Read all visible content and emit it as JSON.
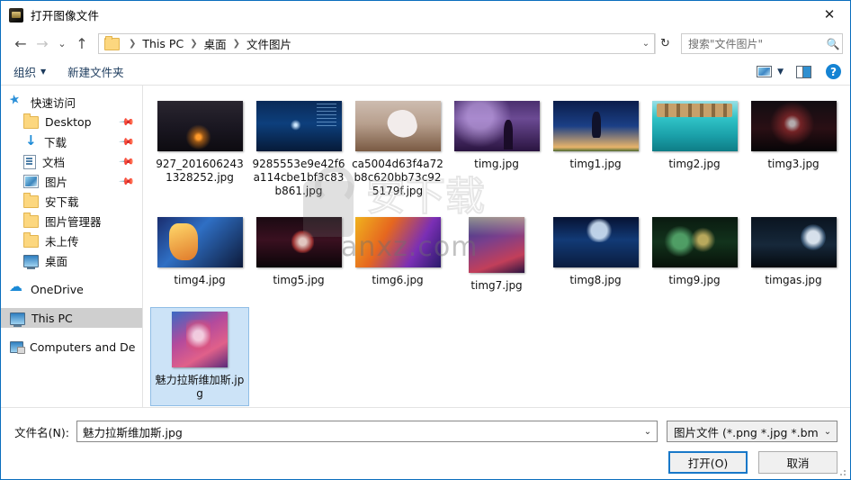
{
  "window": {
    "title": "打开图像文件",
    "app_icon": "image-file-icon",
    "close_label": "✕"
  },
  "nav": {
    "back": "←",
    "forward": "→",
    "recent": "⌄",
    "up": "↑",
    "breadcrumb": [
      "This PC",
      "桌面",
      "文件图片"
    ],
    "breadcrumb_dropdown": "⌄",
    "refresh": "↻"
  },
  "search": {
    "text": "搜索\"文件图片\"",
    "icon": "search-icon"
  },
  "toolbar": {
    "organize": "组织",
    "organize_caret": "▼",
    "new_folder": "新建文件夹",
    "view_caret": "▼",
    "help": "?"
  },
  "sidebar": {
    "items": [
      {
        "label": "快速访问",
        "icon": "star-icon",
        "level": 0,
        "pinned": false,
        "selected": false
      },
      {
        "label": "Desktop",
        "icon": "folder-icon",
        "level": 1,
        "pinned": true,
        "selected": false
      },
      {
        "label": "下载",
        "icon": "download-icon",
        "level": 1,
        "pinned": true,
        "selected": false
      },
      {
        "label": "文档",
        "icon": "document-icon",
        "level": 1,
        "pinned": true,
        "selected": false
      },
      {
        "label": "图片",
        "icon": "picture-icon",
        "level": 1,
        "pinned": true,
        "selected": false
      },
      {
        "label": "安下载",
        "icon": "folder-icon",
        "level": 1,
        "pinned": false,
        "selected": false
      },
      {
        "label": "图片管理器",
        "icon": "folder-icon",
        "level": 1,
        "pinned": false,
        "selected": false
      },
      {
        "label": "未上传",
        "icon": "folder-icon",
        "level": 1,
        "pinned": false,
        "selected": false
      },
      {
        "label": "桌面",
        "icon": "monitor-icon",
        "level": 1,
        "pinned": false,
        "selected": false
      },
      {
        "label": "OneDrive",
        "icon": "cloud-icon",
        "level": 0,
        "pinned": false,
        "selected": false
      },
      {
        "label": "This PC",
        "icon": "monitor-icon",
        "level": 0,
        "pinned": false,
        "selected": true
      },
      {
        "label": "Computers and De",
        "icon": "network-icon",
        "level": 0,
        "pinned": false,
        "selected": false
      }
    ]
  },
  "files": [
    {
      "name": "927_2016062431328252.jpg",
      "art": "t1",
      "selected": false
    },
    {
      "name": "9285553e9e42f6a114cbe1bf3c83b861.jpg",
      "art": "t2",
      "selected": false
    },
    {
      "name": "ca5004d63f4a72b8c620bb73c925179f.jpg",
      "art": "t3",
      "selected": false
    },
    {
      "name": "timg.jpg",
      "art": "t4",
      "selected": false
    },
    {
      "name": "timg1.jpg",
      "art": "t5",
      "selected": false
    },
    {
      "name": "timg2.jpg",
      "art": "t6",
      "selected": false
    },
    {
      "name": "timg3.jpg",
      "art": "t7",
      "selected": false
    },
    {
      "name": "timg4.jpg",
      "art": "t8",
      "selected": false
    },
    {
      "name": "timg5.jpg",
      "art": "t9",
      "selected": false
    },
    {
      "name": "timg6.jpg",
      "art": "t10",
      "selected": false
    },
    {
      "name": "timg7.jpg",
      "art": "t11",
      "selected": false
    },
    {
      "name": "timg8.jpg",
      "art": "t12",
      "selected": false
    },
    {
      "name": "timg9.jpg",
      "art": "t13",
      "selected": false
    },
    {
      "name": "timgas.jpg",
      "art": "t14",
      "selected": false
    },
    {
      "name": "魅力拉斯维加斯.jpg",
      "art": "t15",
      "selected": true
    }
  ],
  "watermark": {
    "site": "anxz.com",
    "cn": "安下载"
  },
  "bottom": {
    "filename_label": "文件名(N):",
    "filename_value": "魅力拉斯维加斯.jpg",
    "filename_caret": "⌄",
    "filetype_value": "图片文件 (*.png *.jpg *.bmp)",
    "filetype_caret": "⌄",
    "open_button": "打开(O)",
    "cancel_button": "取消"
  },
  "colors": {
    "accent": "#1878c8",
    "selection": "#cce3f7",
    "sidebar_selected": "#cfcfcf",
    "border": "#0a6ebd"
  }
}
